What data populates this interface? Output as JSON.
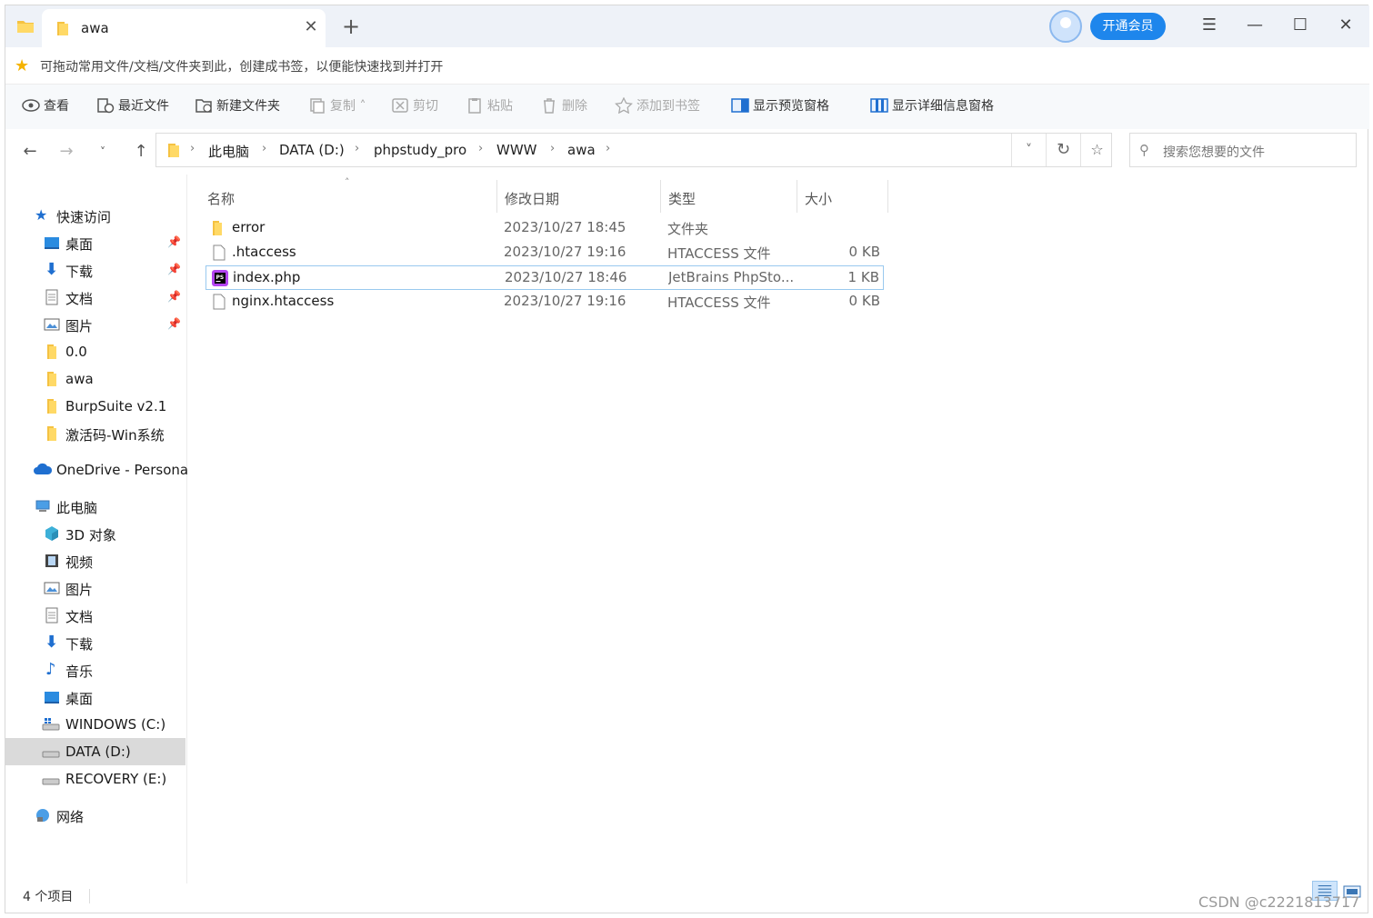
{
  "window": {
    "tab_title": "awa",
    "new_tab": "+",
    "vip_button": "开通会员",
    "controls": {
      "menu": "☰",
      "minimize": "—",
      "maximize": "☐",
      "close": "✕"
    }
  },
  "bookmarks": {
    "hint": "可拖动常用文件/文档/文件夹到此，创建成书签，以便能快速找到并打开"
  },
  "toolbar": {
    "view": "查看",
    "recent": "最近文件",
    "new_folder": "新建文件夹",
    "copy": "复制",
    "cut": "剪切",
    "paste": "粘贴",
    "delete": "删除",
    "add_bookmark": "添加到书签",
    "preview_pane": "显示预览窗格",
    "details_pane": "显示详细信息窗格"
  },
  "address": {
    "segments": [
      "此电脑",
      "DATA (D:)",
      "phpstudy_pro",
      "WWW",
      "awa"
    ]
  },
  "search": {
    "placeholder": "搜索您想要的文件"
  },
  "sidebar": {
    "quick_access": "快速访问",
    "quick_items": [
      "桌面",
      "下载",
      "文档",
      "图片",
      "0.0",
      "awa",
      "BurpSuite v2.1",
      "激活码-Win系统"
    ],
    "onedrive": "OneDrive - Persona",
    "this_pc": "此电脑",
    "pc_items": [
      "3D 对象",
      "视频",
      "图片",
      "文档",
      "下载",
      "音乐",
      "桌面",
      "WINDOWS (C:)",
      "DATA (D:)",
      "RECOVERY (E:)"
    ],
    "network": "网络"
  },
  "columns": {
    "name": "名称",
    "date": "修改日期",
    "type": "类型",
    "size": "大小"
  },
  "files": [
    {
      "name": "error",
      "date": "2023/10/27 18:45",
      "type": "文件夹",
      "size": "",
      "icon": "folder-icon"
    },
    {
      "name": ".htaccess",
      "date": "2023/10/27 19:16",
      "type": "HTACCESS 文件",
      "size": "0 KB",
      "icon": "file-icon"
    },
    {
      "name": "index.php",
      "date": "2023/10/27 18:46",
      "type": "JetBrains PhpSto...",
      "size": "1 KB",
      "icon": "phpstorm-icon"
    },
    {
      "name": "nginx.htaccess",
      "date": "2023/10/27 19:16",
      "type": "HTACCESS 文件",
      "size": "0 KB",
      "icon": "file-icon"
    }
  ],
  "status": {
    "count": "4 个项目"
  },
  "watermark": "CSDN @c2221813717"
}
